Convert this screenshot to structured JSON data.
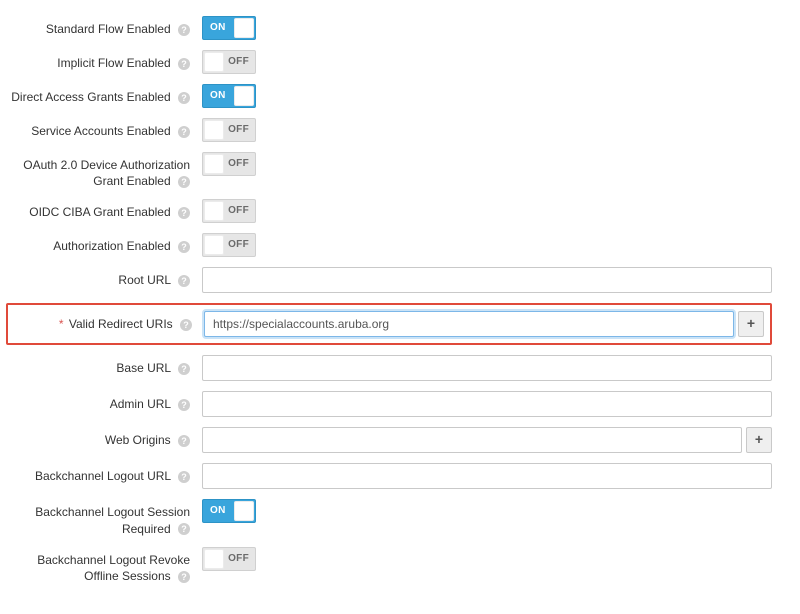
{
  "toggles": {
    "on_text": "ON",
    "off_text": "OFF"
  },
  "rows": {
    "standard_flow": {
      "label": "Standard Flow Enabled",
      "state": "on"
    },
    "implicit_flow": {
      "label": "Implicit Flow Enabled",
      "state": "off"
    },
    "direct_access": {
      "label": "Direct Access Grants Enabled",
      "state": "on"
    },
    "service_accounts": {
      "label": "Service Accounts Enabled",
      "state": "off"
    },
    "oauth_device": {
      "label": "OAuth 2.0 Device Authorization Grant Enabled",
      "state": "off"
    },
    "oidc_ciba": {
      "label": "OIDC CIBA Grant Enabled",
      "state": "off"
    },
    "authorization": {
      "label": "Authorization Enabled",
      "state": "off"
    },
    "root_url": {
      "label": "Root URL",
      "value": ""
    },
    "valid_redirect": {
      "label": "Valid Redirect URIs",
      "value": "https://specialaccounts.aruba.org"
    },
    "base_url": {
      "label": "Base URL",
      "value": ""
    },
    "admin_url": {
      "label": "Admin URL",
      "value": ""
    },
    "web_origins": {
      "label": "Web Origins",
      "value": ""
    },
    "backchannel_url": {
      "label": "Backchannel Logout URL",
      "value": ""
    },
    "backchannel_session": {
      "label": "Backchannel Logout Session Required",
      "state": "on"
    },
    "backchannel_revoke": {
      "label": "Backchannel Logout Revoke Offline Sessions",
      "state": "off"
    }
  },
  "plus_symbol": "+"
}
